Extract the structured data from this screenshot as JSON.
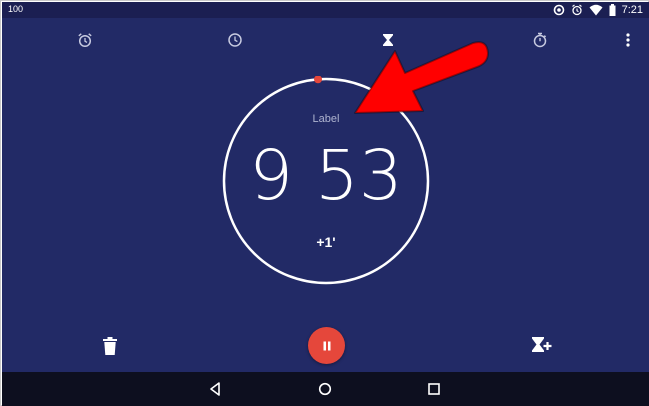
{
  "status_bar": {
    "left_text": "100",
    "time": "7:21",
    "icons": [
      "sync-icon",
      "alarm-icon",
      "wifi-icon",
      "battery-icon"
    ]
  },
  "tabs": [
    {
      "name": "alarm-tab",
      "icon": "alarm-icon"
    },
    {
      "name": "clock-tab",
      "icon": "clock-icon"
    },
    {
      "name": "timer-tab",
      "icon": "hourglass-icon",
      "selected": true
    },
    {
      "name": "stopwatch-tab",
      "icon": "stopwatch-icon"
    }
  ],
  "menu_icon": "more-vert-icon",
  "timer": {
    "label": "Label",
    "time": "9 53",
    "add_minute": "+1'"
  },
  "actions": {
    "delete_icon": "trash-icon",
    "pause_icon": "pause-icon",
    "add_timer_icon": "add-timer-icon"
  },
  "nav_bar": [
    "back-icon",
    "home-icon",
    "recents-icon"
  ],
  "colors": {
    "background": "#222a66",
    "status_bar": "#1b1f52",
    "nav_bar": "#0d0f1f",
    "accent": "#e5473b",
    "annotation_arrow": "#ff0000"
  }
}
